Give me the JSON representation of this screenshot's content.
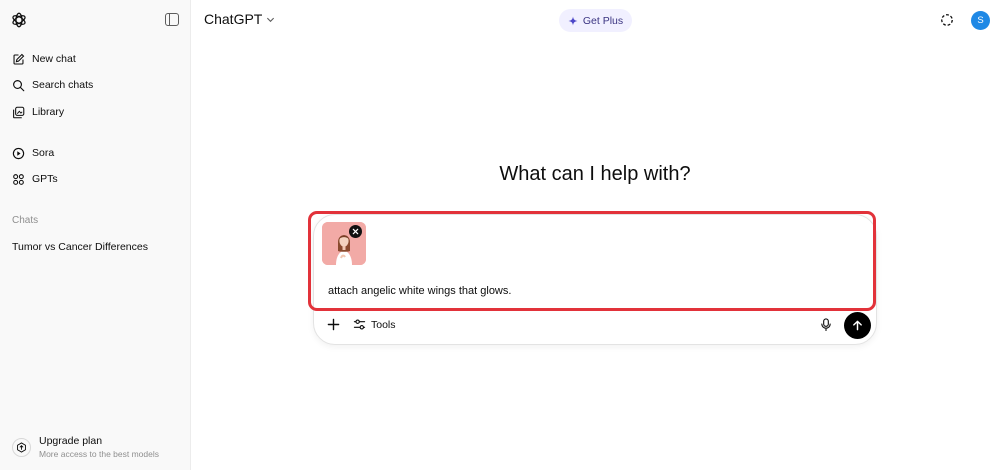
{
  "sidebar": {
    "logo_icon": "openai-logo-icon",
    "toggle_icon": "sidebar-toggle-icon",
    "items": [
      {
        "label": "New chat",
        "icon": "pencil-square-icon"
      },
      {
        "label": "Search chats",
        "icon": "search-icon"
      },
      {
        "label": "Library",
        "icon": "library-icon"
      },
      {
        "label": "Sora",
        "icon": "play-circle-icon"
      },
      {
        "label": "GPTs",
        "icon": "grid-dots-icon"
      }
    ],
    "section_title": "Chats",
    "chats": [
      "Tumor vs Cancer Differences"
    ],
    "upgrade": {
      "title": "Upgrade plan",
      "subtitle": "More access to the best models",
      "icon": "upgrade-icon"
    }
  },
  "header": {
    "model_label": "ChatGPT",
    "get_plus_label": "Get Plus",
    "avatar_initial": "S",
    "accent_color": "#1e88e5"
  },
  "main": {
    "heading": "What can I help with?"
  },
  "composer": {
    "attachment": "image-attachment-icon",
    "prompt_text": "attach angelic white wings that glows.",
    "tools_label": "Tools",
    "highlight_color": "#e2323a"
  }
}
